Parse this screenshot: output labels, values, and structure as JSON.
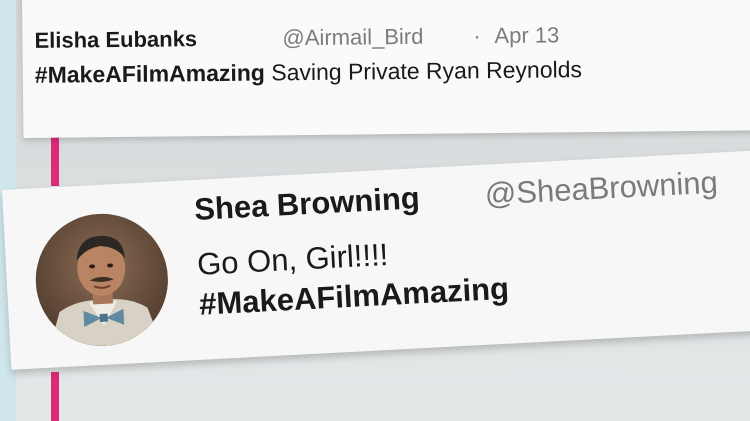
{
  "tweets": [
    {
      "author_name": "Elisha Eubanks",
      "handle": "@Airmail_Bird",
      "separator": "·",
      "date": "Apr 13",
      "hashtag": "#MakeAFilmAmazing",
      "text": " Saving Private Ryan Reynolds"
    },
    {
      "author_name": "Shea Browning",
      "handle": "@SheaBrowning",
      "text_line1": "Go On, Girl!!!!",
      "text_line2": "#MakeAFilmAmazing",
      "avatar_icon": "profile-photo-man-bowtie"
    }
  ],
  "colors": {
    "timeline_accent": "#df2a78",
    "name_text": "#1a1a1a",
    "handle_text": "#7c7c7c",
    "left_strip": "#cfe6ec"
  }
}
